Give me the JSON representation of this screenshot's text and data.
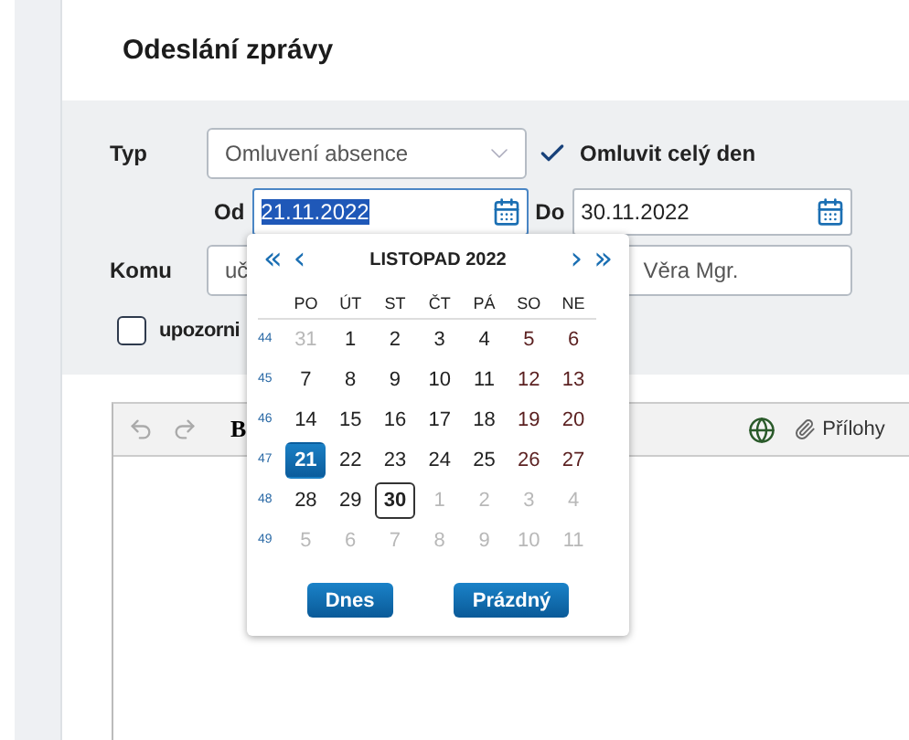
{
  "header": {
    "title": "Odeslání zprávy"
  },
  "form": {
    "type_label": "Typ",
    "type_value": "Omluvení absence",
    "whole_day": {
      "label": "Omluvit celý den",
      "checked": true
    },
    "from_label": "Od",
    "from_value": "21.11.2022",
    "to_label": "Do",
    "to_value": "30.11.2022",
    "to_field_label": "Komu",
    "recipient_start": "uč",
    "recipient_end": "Věra Mgr.",
    "notify": {
      "label": "upozorni",
      "checked": false
    }
  },
  "editor": {
    "bold": "B",
    "attachments": "Přílohy"
  },
  "datepicker": {
    "prev_year": "«",
    "prev_month": "‹",
    "title": "LISTOPAD 2022",
    "next_month": "›",
    "next_year": "»",
    "weekdays": [
      "PO",
      "ÚT",
      "ST",
      "ČT",
      "PÁ",
      "SO",
      "NE"
    ],
    "weeks": [
      {
        "number": "44",
        "days": [
          {
            "label": "31",
            "muted": true,
            "selected": false,
            "today": false
          },
          {
            "label": "1",
            "muted": false,
            "selected": false,
            "today": false
          },
          {
            "label": "2",
            "muted": false,
            "selected": false,
            "today": false
          },
          {
            "label": "3",
            "muted": false,
            "selected": false,
            "today": false
          },
          {
            "label": "4",
            "muted": false,
            "selected": false,
            "today": false
          },
          {
            "label": "5",
            "muted": false,
            "selected": false,
            "today": false
          },
          {
            "label": "6",
            "muted": false,
            "selected": false,
            "today": false
          }
        ]
      },
      {
        "number": "45",
        "days": [
          {
            "label": "7",
            "muted": false,
            "selected": false,
            "today": false
          },
          {
            "label": "8",
            "muted": false,
            "selected": false,
            "today": false
          },
          {
            "label": "9",
            "muted": false,
            "selected": false,
            "today": false
          },
          {
            "label": "10",
            "muted": false,
            "selected": false,
            "today": false
          },
          {
            "label": "11",
            "muted": false,
            "selected": false,
            "today": false
          },
          {
            "label": "12",
            "muted": false,
            "selected": false,
            "today": false
          },
          {
            "label": "13",
            "muted": false,
            "selected": false,
            "today": false
          }
        ]
      },
      {
        "number": "46",
        "days": [
          {
            "label": "14",
            "muted": false,
            "selected": false,
            "today": false
          },
          {
            "label": "15",
            "muted": false,
            "selected": false,
            "today": false
          },
          {
            "label": "16",
            "muted": false,
            "selected": false,
            "today": false
          },
          {
            "label": "17",
            "muted": false,
            "selected": false,
            "today": false
          },
          {
            "label": "18",
            "muted": false,
            "selected": false,
            "today": false
          },
          {
            "label": "19",
            "muted": false,
            "selected": false,
            "today": false
          },
          {
            "label": "20",
            "muted": false,
            "selected": false,
            "today": false
          }
        ]
      },
      {
        "number": "47",
        "days": [
          {
            "label": "21",
            "muted": false,
            "selected": true,
            "today": false
          },
          {
            "label": "22",
            "muted": false,
            "selected": false,
            "today": false
          },
          {
            "label": "23",
            "muted": false,
            "selected": false,
            "today": false
          },
          {
            "label": "24",
            "muted": false,
            "selected": false,
            "today": false
          },
          {
            "label": "25",
            "muted": false,
            "selected": false,
            "today": false
          },
          {
            "label": "26",
            "muted": false,
            "selected": false,
            "today": false
          },
          {
            "label": "27",
            "muted": false,
            "selected": false,
            "today": false
          }
        ]
      },
      {
        "number": "48",
        "days": [
          {
            "label": "28",
            "muted": false,
            "selected": false,
            "today": false
          },
          {
            "label": "29",
            "muted": false,
            "selected": false,
            "today": false
          },
          {
            "label": "30",
            "muted": false,
            "selected": false,
            "today": true
          },
          {
            "label": "1",
            "muted": true,
            "selected": false,
            "today": false
          },
          {
            "label": "2",
            "muted": true,
            "selected": false,
            "today": false
          },
          {
            "label": "3",
            "muted": true,
            "selected": false,
            "today": false
          },
          {
            "label": "4",
            "muted": true,
            "selected": false,
            "today": false
          }
        ]
      },
      {
        "number": "49",
        "days": [
          {
            "label": "5",
            "muted": true,
            "selected": false,
            "today": false
          },
          {
            "label": "6",
            "muted": true,
            "selected": false,
            "today": false
          },
          {
            "label": "7",
            "muted": true,
            "selected": false,
            "today": false
          },
          {
            "label": "8",
            "muted": true,
            "selected": false,
            "today": false
          },
          {
            "label": "9",
            "muted": true,
            "selected": false,
            "today": false
          },
          {
            "label": "10",
            "muted": true,
            "selected": false,
            "today": false
          },
          {
            "label": "11",
            "muted": true,
            "selected": false,
            "today": false
          }
        ]
      }
    ],
    "buttons": [
      "Dnes",
      "Prázdný"
    ]
  }
}
